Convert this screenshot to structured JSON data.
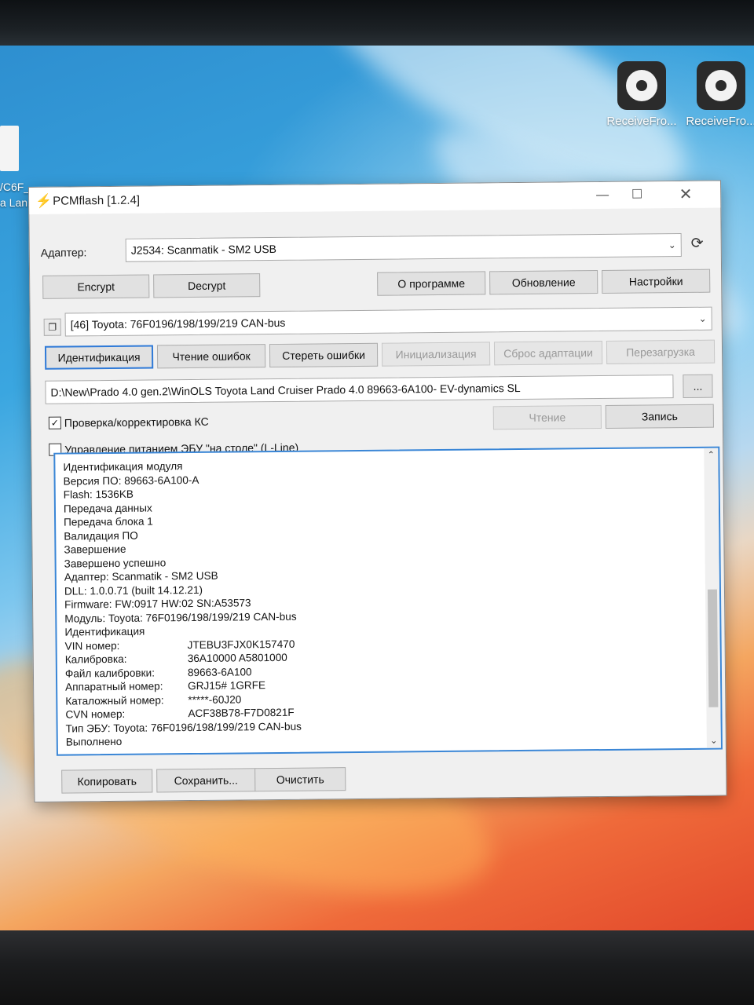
{
  "desktop": {
    "icons": [
      {
        "label": "ReceiveFro..."
      },
      {
        "label": "ReceiveFro..."
      }
    ],
    "file_label_lines": [
      "/C6F_...",
      "a Lan..."
    ]
  },
  "window": {
    "title": "PCMflash [1.2.4]",
    "app_icon": "⚡",
    "controls": {
      "minimize": "—",
      "maximize": "☐",
      "close": "✕"
    }
  },
  "adapter": {
    "label": "Адаптер:",
    "value": "J2534: Scanmatik - SM2 USB"
  },
  "toolbar": {
    "encrypt": "Encrypt",
    "decrypt": "Decrypt",
    "about": "О программе",
    "update": "Обновление",
    "settings": "Настройки"
  },
  "module": {
    "value": "[46] Toyota: 76F0196/198/199/219 CAN-bus"
  },
  "actions": {
    "identify": "Идентификация",
    "read_errors": "Чтение ошибок",
    "clear_errors": "Стереть ошибки",
    "initialization": "Инициализация",
    "reset_adaptation": "Сброс адаптации",
    "reboot": "Перезагрузка"
  },
  "file": {
    "path": "D:\\New\\Prado 4.0 gen.2\\WinOLS Toyota Land Cruiser Prado 4.0 89663-6A100- EV-dynamics SL",
    "browse": "..."
  },
  "options": {
    "checksum_label": "Проверка/корректировка КС",
    "checksum_checked": true,
    "power_label": "Управление питанием ЭБУ \"на столе\" (L-Line)",
    "power_checked": false
  },
  "rw": {
    "read": "Чтение",
    "write": "Запись"
  },
  "log": {
    "lines": [
      "Идентификация модуля",
      "Версия ПО: 89663-6A100-A",
      "Flash: 1536KB",
      "Передача данных",
      "Передача блока 1",
      "Валидация ПО",
      "Завершение",
      "Завершено успешно",
      "Адаптер: Scanmatik - SM2 USB",
      "DLL: 1.0.0.71 (built 14.12.21)",
      "Firmware: FW:0917 HW:02 SN:A53573",
      "Модуль: Toyota: 76F0196/198/199/219 CAN-bus",
      "Идентификация"
    ],
    "pairs": [
      {
        "k": "VIN номер:",
        "v": "JTEBU3FJX0K157470"
      },
      {
        "k": "Калибровка:",
        "v": "36A10000 A5801000"
      },
      {
        "k": "Файл калибровки:",
        "v": "89663-6A100"
      },
      {
        "k": "Аппаратный номер:",
        "v": "GRJ15# 1GRFE"
      },
      {
        "k": "Каталожный номер:",
        "v": "*****-60J20"
      },
      {
        "k": "CVN номер:",
        "v": "ACF38B78-F7D0821F"
      }
    ],
    "tail": [
      "Тип ЭБУ: Toyota: 76F0196/198/199/219 CAN-bus",
      "Выполнено"
    ]
  },
  "bottom": {
    "copy": "Копировать",
    "save": "Сохранить...",
    "clear": "Очистить"
  }
}
